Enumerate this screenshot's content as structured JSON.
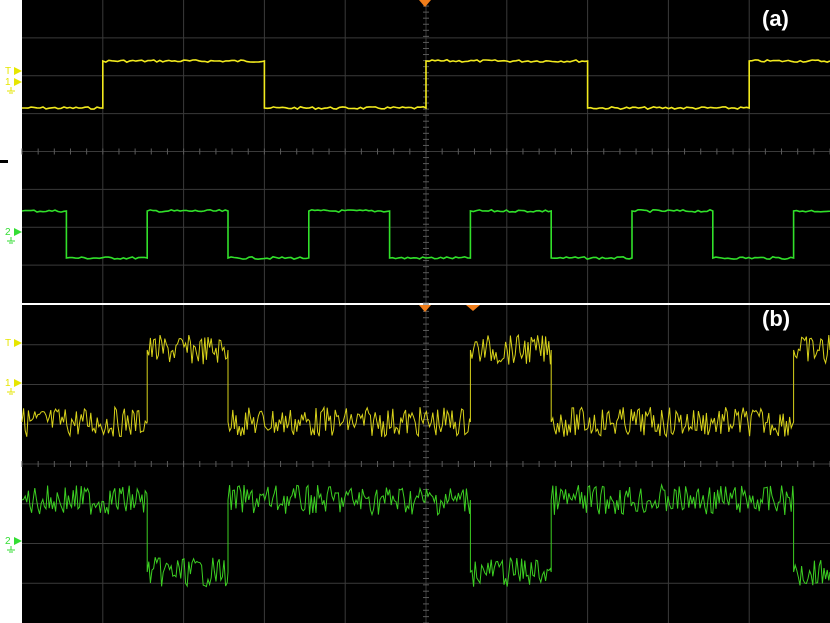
{
  "chart_data": [
    {
      "type": "line",
      "panel_label": "(a)",
      "grid": true,
      "background": "#000000",
      "grid_color": "#3a3a3a",
      "trigger_marker_color": "#f07d1a",
      "x_divisions": 10,
      "y_divisions": 8,
      "channel_markers": [
        {
          "text": "T",
          "color": "#e6e600",
          "kind": "trigger-level"
        },
        {
          "text": "1",
          "color": "#e6e600",
          "kind": "channel-ground"
        },
        {
          "text": "2",
          "color": "#33dd33",
          "kind": "channel-ground"
        }
      ],
      "series": [
        {
          "color": "#f2ea1e",
          "low": 0,
          "high": 1,
          "noise": 0.02,
          "steps": [
            [
              0,
              0
            ],
            [
              1.0,
              1
            ],
            [
              3.0,
              0
            ],
            [
              5.0,
              1
            ],
            [
              7.0,
              0
            ],
            [
              9.0,
              1
            ],
            [
              10.0,
              1
            ]
          ]
        },
        {
          "color": "#31e02a",
          "low": 0,
          "high": 1,
          "noise": 0.02,
          "steps": [
            [
              0,
              1
            ],
            [
              0.55,
              0
            ],
            [
              1.55,
              1
            ],
            [
              2.55,
              0
            ],
            [
              3.55,
              1
            ],
            [
              4.55,
              0
            ],
            [
              5.55,
              1
            ],
            [
              6.55,
              0
            ],
            [
              7.55,
              1
            ],
            [
              8.55,
              0
            ],
            [
              9.55,
              1
            ],
            [
              10.0,
              1
            ]
          ]
        }
      ]
    },
    {
      "type": "line",
      "panel_label": "(b)",
      "grid": true,
      "background": "#000000",
      "grid_color": "#3a3a3a",
      "trigger_marker_color": "#f07d1a",
      "x_divisions": 10,
      "y_divisions": 8,
      "channel_markers": [
        {
          "text": "T",
          "color": "#e6e600",
          "kind": "trigger-level"
        },
        {
          "text": "1",
          "color": "#e6e600",
          "kind": "channel-ground"
        },
        {
          "text": "2",
          "color": "#33dd33",
          "kind": "channel-ground"
        }
      ],
      "series": [
        {
          "color": "#d8d21a",
          "low": 0,
          "high": 1,
          "noise": 0.18,
          "steps": [
            [
              0,
              0
            ],
            [
              1.55,
              1
            ],
            [
              2.55,
              0
            ],
            [
              5.55,
              1
            ],
            [
              6.55,
              0
            ],
            [
              9.55,
              1
            ],
            [
              10.0,
              1
            ]
          ]
        },
        {
          "color": "#3ccf22",
          "low": 0,
          "high": 1,
          "noise": 0.18,
          "steps": [
            [
              0,
              1
            ],
            [
              1.55,
              0
            ],
            [
              2.55,
              1
            ],
            [
              5.55,
              0
            ],
            [
              6.55,
              1
            ],
            [
              9.55,
              0
            ],
            [
              10.0,
              0
            ]
          ]
        }
      ]
    }
  ]
}
